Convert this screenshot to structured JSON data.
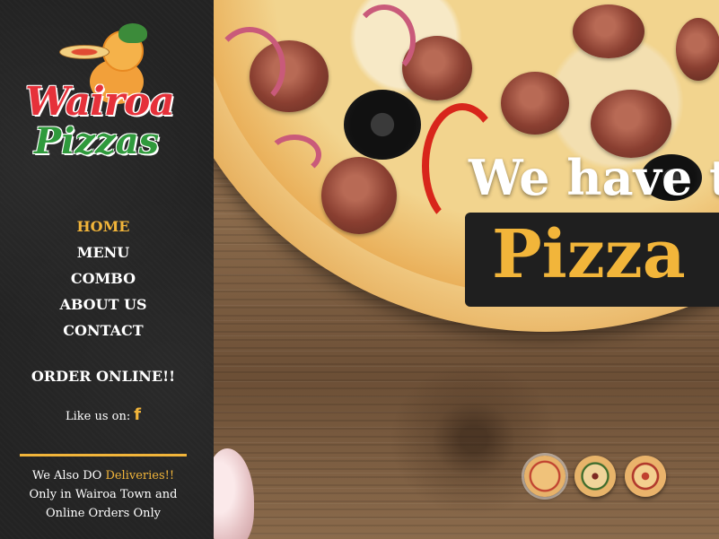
{
  "brand": {
    "line1": "Wairoa",
    "line2": "Pizzas"
  },
  "nav": {
    "items": [
      {
        "label": "HOME",
        "active": true
      },
      {
        "label": "MENU",
        "active": false
      },
      {
        "label": "COMBO",
        "active": false
      },
      {
        "label": "ABOUT US",
        "active": false
      },
      {
        "label": "CONTACT",
        "active": false
      }
    ]
  },
  "order_online": "ORDER ONLINE!!",
  "social": {
    "like_label": "Like us on:",
    "facebook_glyph": "f"
  },
  "delivery": {
    "prefix": "We Also DO ",
    "highlight": "Deliveries!!",
    "line2": "Only in Wairoa Town and",
    "line3": "Online Orders Only"
  },
  "hero": {
    "headline": "We have t",
    "highlight_word": "Pizza"
  },
  "slider": {
    "thumbnails": 3,
    "active_index": 0
  },
  "colors": {
    "accent": "#f2b53a",
    "sidebar_bg": "#232323",
    "brand_red": "#e6313a",
    "brand_green": "#2f9a3c"
  }
}
